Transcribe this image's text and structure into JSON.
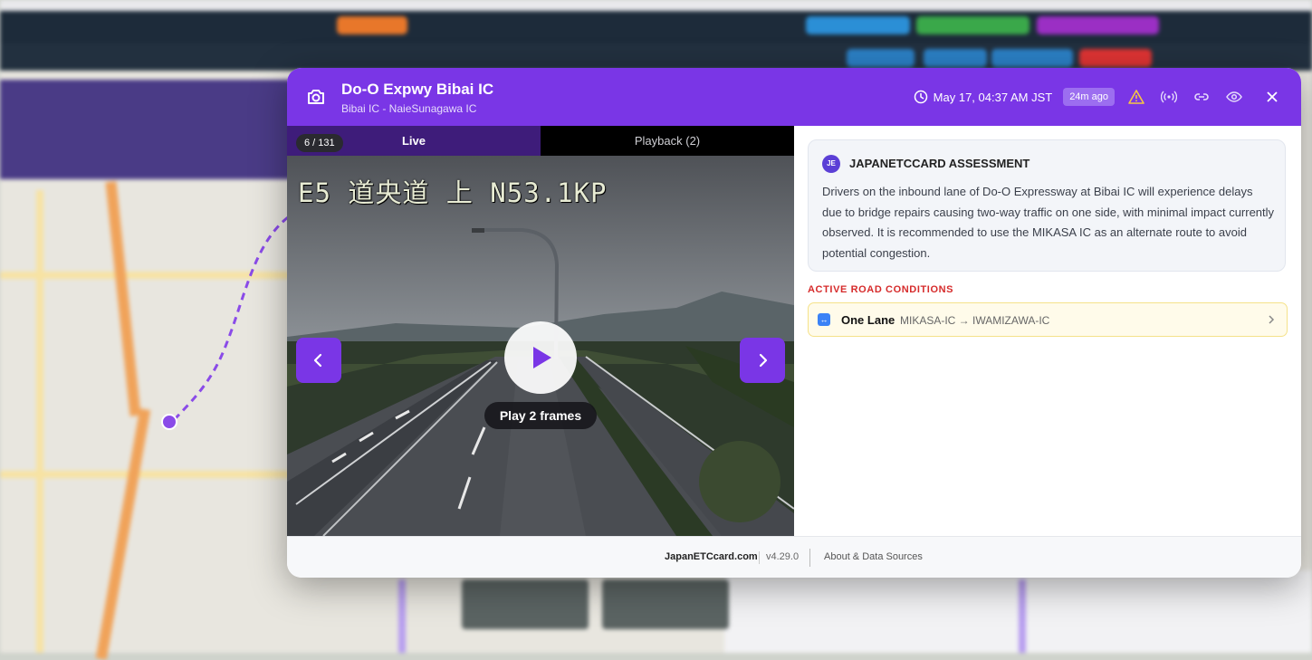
{
  "modal": {
    "title": "Do-O Expwy Bibai IC",
    "subtitle": "Bibai IC - NaieSunagawa IC",
    "timestamp": "May 17, 04:37 AM JST",
    "age_badge": "24m ago",
    "icons": [
      "camera-icon",
      "clock-icon",
      "warning-icon",
      "broadcast-icon",
      "link-icon",
      "eye-icon",
      "close-icon"
    ]
  },
  "viewer": {
    "counter": "6 / 131",
    "tabs": {
      "live": "Live",
      "playback": "Playback (2)"
    },
    "camera_overlay": "E5 道央道 上 N53.1KP",
    "play_label": "Play 2 frames"
  },
  "assessment": {
    "badge": "JE",
    "title": "JAPANETCCARD ASSESSMENT",
    "body": "Drivers on the inbound lane of Do-O Expressway at Bibai IC will experience delays due to bridge repairs causing two-way traffic on one side, with minimal impact currently observed. It is recommended to use the MIKASA IC as an alternate route to avoid potential congestion."
  },
  "conditions": {
    "heading": "ACTIVE ROAD CONDITIONS",
    "items": [
      {
        "icon": "↔",
        "type": "One Lane",
        "segment": "MIKASA-IC → IWAMIZAWA-IC"
      }
    ]
  },
  "footer": {
    "brand": "JapanETCcard.com",
    "version": "v4.29.0",
    "about": "About & Data Sources"
  },
  "colors": {
    "accent": "#7a36e6",
    "alert": "#d62b2b",
    "condition_bg": "#fffbea"
  }
}
